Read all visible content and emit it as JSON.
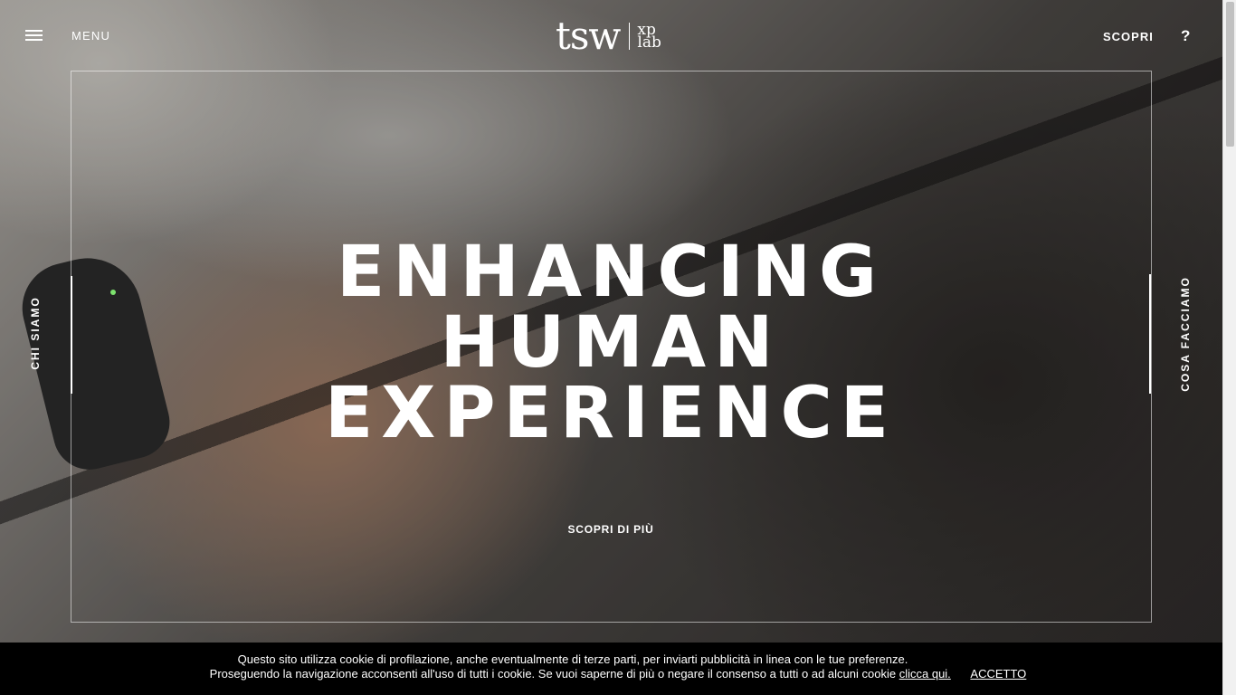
{
  "header": {
    "menu_label": "MENU",
    "logo_main": "tsw",
    "logo_sub_top": "xp",
    "logo_sub_bottom": "lab",
    "scopri_label": "SCOPRI",
    "help_label": "?"
  },
  "side_nav": {
    "left_label": "CHI SIAMO",
    "right_label": "COSA FACCIAMO"
  },
  "hero": {
    "title_lines": [
      "ENHANCING",
      "HUMAN",
      "EXPERIENCE"
    ],
    "cta_label": "SCOPRI DI PIÙ"
  },
  "cookie": {
    "line1": "Questo sito utilizza cookie di profilazione, anche eventualmente di terze parti, per inviarti pubblicità in linea con le tue preferenze.",
    "line2": "Proseguendo la navigazione acconsenti all'uso di tutti i cookie. Se vuoi saperne di più o negare il consenso a tutti o ad alcuni cookie",
    "link_label": "clicca qui.",
    "accept_label": "ACCETTO"
  },
  "colors": {
    "text": "#ffffff",
    "cookie_bg": "#000000"
  },
  "icons": [
    "hamburger-icon",
    "help-icon"
  ]
}
